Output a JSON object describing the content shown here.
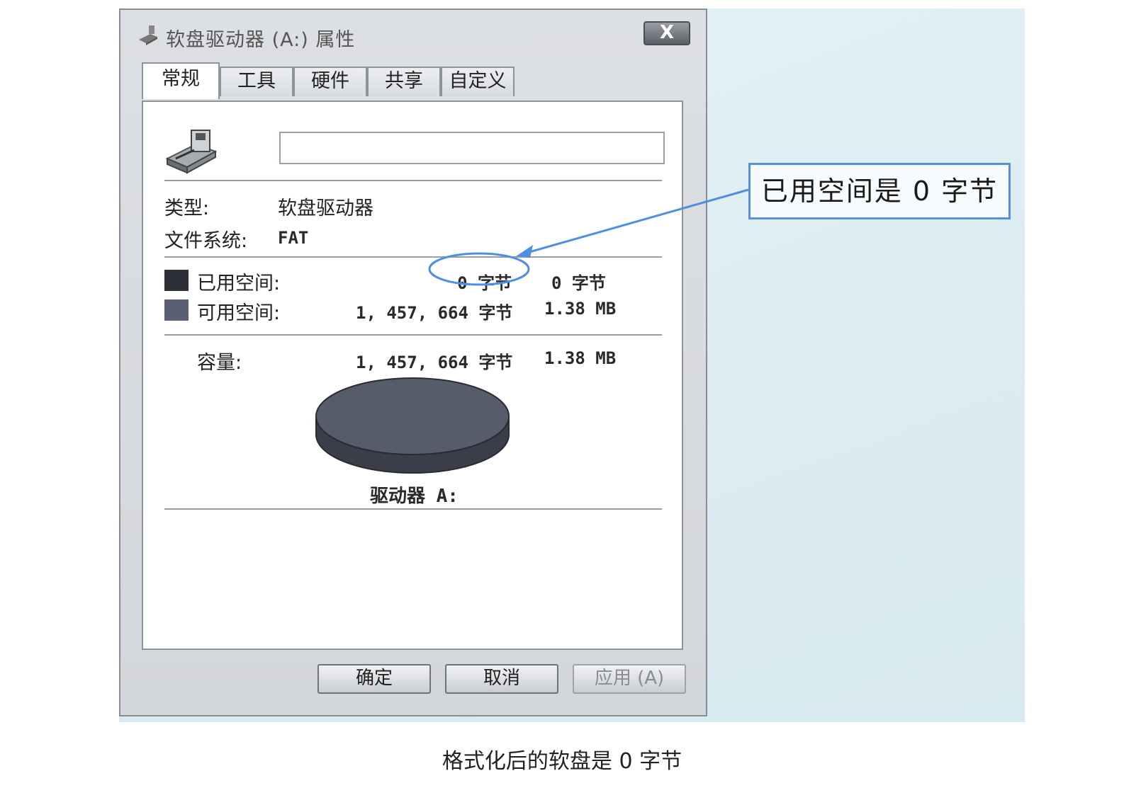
{
  "window": {
    "title": "软盘驱动器 (A:) 属性",
    "close_label": "X"
  },
  "tabs": [
    {
      "label": "常规",
      "active": true
    },
    {
      "label": "工具",
      "active": false
    },
    {
      "label": "硬件",
      "active": false
    },
    {
      "label": "共享",
      "active": false
    },
    {
      "label": "自定义",
      "active": false
    }
  ],
  "general": {
    "name_value": "",
    "type_label": "类型:",
    "type_value": "软盘驱动器",
    "fs_label": "文件系统:",
    "fs_value": "FAT",
    "used_label": "已用空间:",
    "used_bytes": "0 字节",
    "used_size": "0 字节",
    "free_label": "可用空间:",
    "free_bytes": "1, 457, 664 字节",
    "free_size": "1.38 MB",
    "capacity_label": "容量:",
    "capacity_bytes": "1, 457, 664 字节",
    "capacity_size": "1.38 MB",
    "drive_label": "驱动器 A:"
  },
  "buttons": {
    "ok": "确定",
    "cancel": "取消",
    "apply": "应用 (A)"
  },
  "callout": {
    "text": "已用空间是 0 字节"
  },
  "caption": "格式化后的软盘是 0 字节",
  "colors": {
    "used_swatch": "#2e3038",
    "free_swatch": "#5a5f72",
    "pie_top": "#575c6b",
    "pie_side": "#3b3e49",
    "callout_border": "#5b8fd6"
  },
  "chart_data": {
    "type": "pie",
    "categories": [
      "已用空间",
      "可用空间"
    ],
    "values": [
      0,
      1457664
    ]
  }
}
